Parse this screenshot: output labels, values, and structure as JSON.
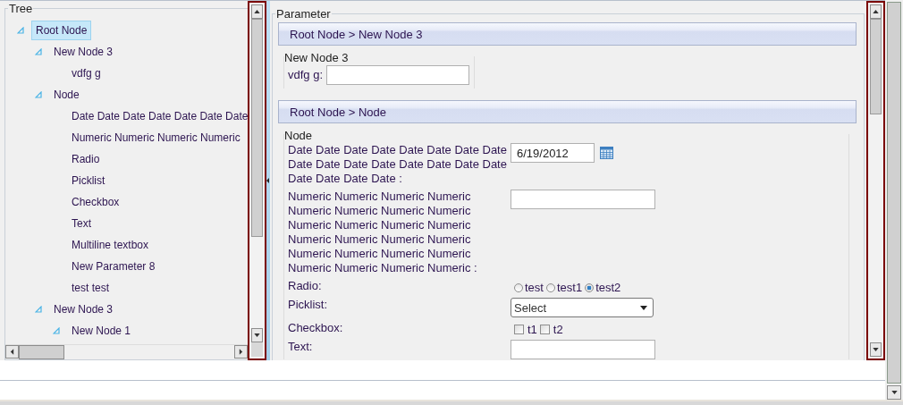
{
  "tree": {
    "title": "Tree",
    "items": [
      {
        "kind": "folder",
        "label": "Root Node",
        "selected": true,
        "expanded": true,
        "children": [
          {
            "kind": "folder",
            "label": "New Node 3",
            "selected": false,
            "expanded": true,
            "children": [
              {
                "label": "vdfg g",
                "selected": false
              }
            ]
          },
          {
            "kind": "folder",
            "label": "Node",
            "selected": false,
            "expanded": true,
            "children": [
              {
                "label": "Date Date Date Date Date Date Date",
                "selected": false
              },
              {
                "label": "Numeric Numeric Numeric Numeric",
                "selected": false
              },
              {
                "label": "Radio",
                "selected": false
              },
              {
                "label": "Picklist",
                "selected": false
              },
              {
                "label": "Checkbox",
                "selected": false
              },
              {
                "label": "Text",
                "selected": false
              },
              {
                "label": "Multiline textbox",
                "selected": false
              },
              {
                "label": "New Parameter 8",
                "selected": false
              },
              {
                "label": "test test",
                "selected": false
              }
            ]
          },
          {
            "kind": "folder",
            "label": "New Node 3",
            "selected": false,
            "expanded": true,
            "children": [
              {
                "kind": "folder",
                "label": "New Node 1",
                "selected": false,
                "expanded": true
              }
            ]
          }
        ]
      }
    ]
  },
  "parameter": {
    "title": "Parameter",
    "sections": [
      {
        "breadcrumb": "Root Node > New Node 3",
        "group": "New Node 3",
        "fields": [
          {
            "kind": "text",
            "label": "vdfg g:"
          }
        ]
      },
      {
        "breadcrumb": "Root Node > Node",
        "group": "Node",
        "fields": [
          {
            "kind": "date",
            "label": "Date Date Date Date Date Date Date Date Date Date Date Date Date Date Date Date Date Date Date Date :",
            "value": "6/19/2012"
          },
          {
            "kind": "wide",
            "label": "Numeric Numeric Numeric Numeric Numeric Numeric Numeric Numeric Numeric Numeric Numeric Numeric Numeric Numeric Numeric Numeric Numeric Numeric Numeric Numeric Numeric Numeric Numeric Numeric :"
          },
          {
            "kind": "radio",
            "label": "Radio:",
            "options": [
              {
                "label": "test",
                "selected": false
              },
              {
                "label": "test1",
                "selected": false
              },
              {
                "label": "test2",
                "selected": true
              }
            ]
          },
          {
            "kind": "select",
            "label": "Picklist:",
            "value": "Select"
          },
          {
            "kind": "checkbox",
            "label": "Checkbox:",
            "options": [
              {
                "label": "t1",
                "checked": false
              },
              {
                "label": "t2",
                "checked": false
              }
            ]
          },
          {
            "kind": "wide",
            "label": "Text:"
          }
        ]
      }
    ]
  }
}
